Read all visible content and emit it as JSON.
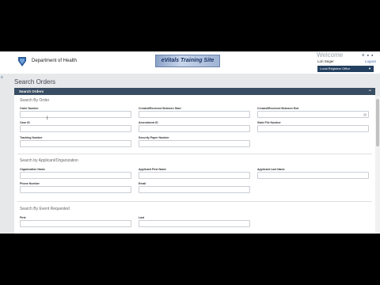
{
  "header": {
    "dept_name": "Department of Health",
    "training_banner": "eVitals Training Site",
    "welcome": "Welcome",
    "user_name": "Lori Seger",
    "logout": "Logout",
    "office_select": "Local Registrar Office"
  },
  "page": {
    "title": "Search Orders"
  },
  "panel": {
    "title": "Search Orders",
    "toggle": "−"
  },
  "sections": {
    "by_order": "Search By Order",
    "by_applicant": "Search by Applicant/Organization",
    "by_event": "Search By Event Requested"
  },
  "labels": {
    "order_number": "Order Number",
    "created_start": "Created/Received Between Start",
    "created_end": "Created/Received Between End",
    "case_id": "Case ID",
    "amendment_id": "Amendment ID",
    "state_file_number": "State File Number",
    "tracking_number": "Tracking Number",
    "security_paper": "Security Paper Number",
    "org_name": "Organization Name",
    "applicant_first": "Applicant First Name",
    "applicant_last": "Applicant Last Name",
    "phone": "Phone Number",
    "email": "Email",
    "first": "First",
    "last": "Last"
  },
  "icons": {
    "calendar": "calendar-icon",
    "menu": "hamburger-menu-icon"
  }
}
